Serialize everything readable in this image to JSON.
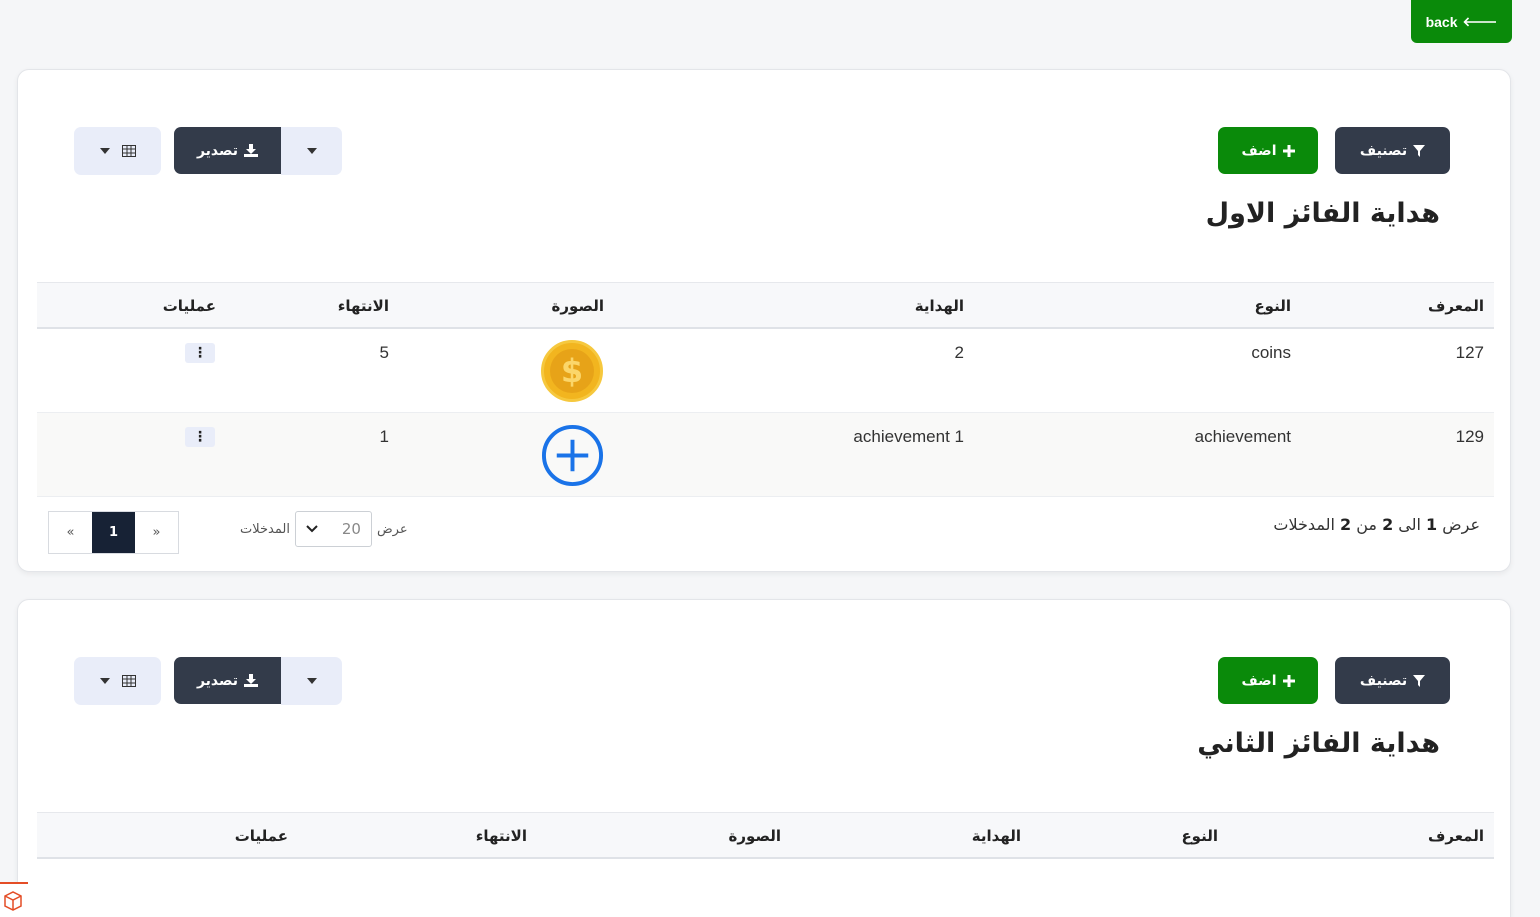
{
  "back_button": {
    "label": "back",
    "icon": "arrow-left-icon"
  },
  "toolbar": {
    "filter_label": "تصنيف",
    "add_label": "اضف",
    "export_label": "تصدير"
  },
  "tables": [
    {
      "title": "هداية الفائز الاول",
      "columns": [
        "المعرف",
        "النوع",
        "الهداية",
        "الصورة",
        "الانتهاء",
        "عمليات"
      ],
      "rows": [
        {
          "id": "127",
          "type": "coins",
          "gift": "2",
          "image": "coin-icon",
          "expiry": "5"
        },
        {
          "id": "129",
          "type": "achievement",
          "gift": "achievement 1",
          "image": "plus-circle-icon",
          "expiry": "1"
        }
      ],
      "footer": {
        "showing_prefix": "عرض",
        "from": "1",
        "to_word": "الى",
        "to": "2",
        "of_word": "من",
        "total": "2",
        "entries_word": "المدخلات"
      },
      "per_page": {
        "show_label": "عرض",
        "value": "20",
        "entries_label": "المدخلات"
      },
      "pagination": {
        "prev": "«",
        "current": "1",
        "next": "»"
      }
    },
    {
      "title": "هداية الفائز الثاني",
      "columns": [
        "المعرف",
        "النوع",
        "الهداية",
        "الصورة",
        "الانتهاء",
        "عمليات"
      ]
    }
  ],
  "colors": {
    "primary_green": "#0a8a0a",
    "dark_button": "#333b4a",
    "light_button": "#e9edf9",
    "active_page": "#172235"
  }
}
